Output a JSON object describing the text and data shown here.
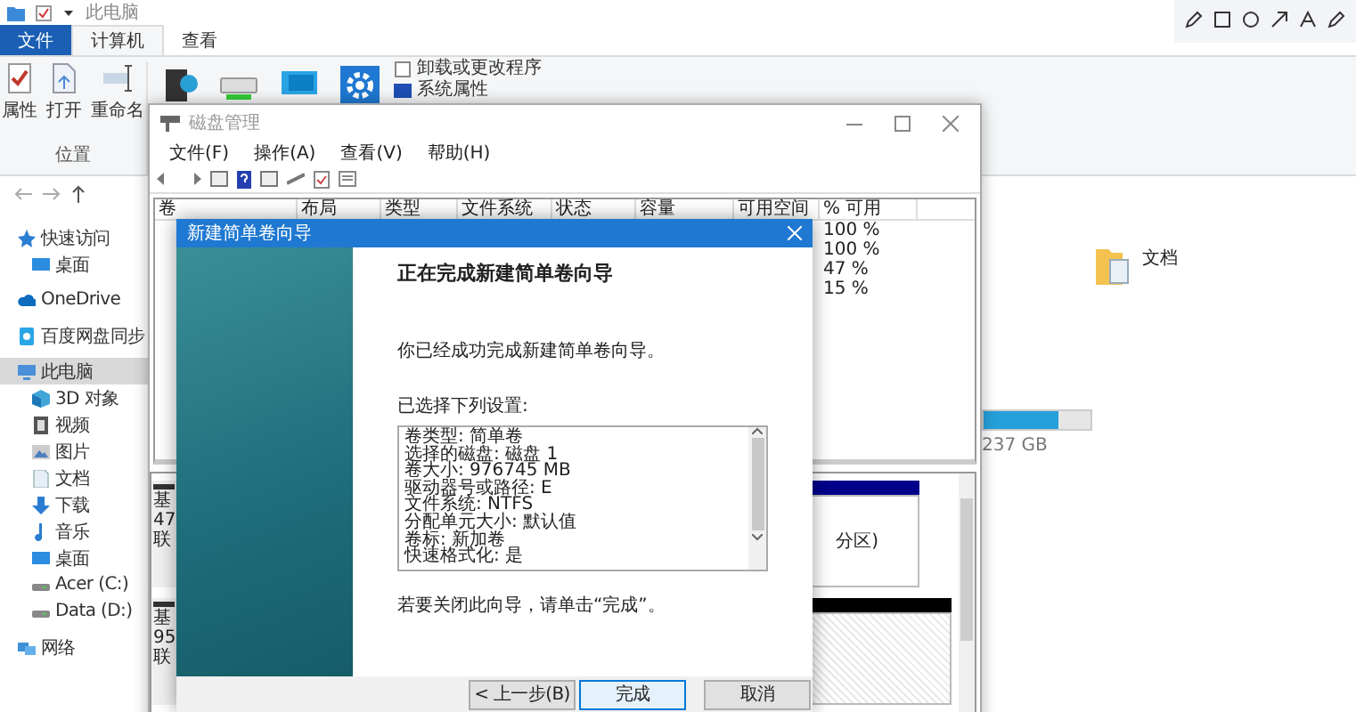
{
  "explorer": {
    "title": "此电脑",
    "ribbon_tabs": [
      {
        "label": "文件",
        "kind": "file",
        "selected": false
      },
      {
        "label": "计算机",
        "kind": "tab",
        "selected": true
      },
      {
        "label": "查看",
        "kind": "tab",
        "selected": false
      }
    ],
    "ribbon_buttons": [
      {
        "label": "属性",
        "kind": "properties"
      },
      {
        "label": "打开",
        "kind": "open"
      },
      {
        "label": "重命名",
        "kind": "rename"
      }
    ],
    "ribbon_group": "位置",
    "system_links": [
      {
        "label": "卸载或更改程序",
        "kind": "uninstall"
      },
      {
        "label": "系统属性",
        "kind": "sysprops"
      }
    ],
    "nav": [
      {
        "label": "快速访问",
        "kind": "star",
        "selected": false,
        "children": [
          {
            "label": "桌面",
            "kind": "desktop",
            "selected": false
          }
        ]
      },
      {
        "label": "OneDrive",
        "kind": "cloud",
        "selected": false
      },
      {
        "label": "百度网盘同步",
        "kind": "sync",
        "selected": false
      },
      {
        "label": "此电脑",
        "kind": "pc",
        "selected": true,
        "children": [
          {
            "label": "3D 对象",
            "kind": "cube",
            "selected": false
          },
          {
            "label": "视频",
            "kind": "video",
            "selected": false
          },
          {
            "label": "图片",
            "kind": "picture",
            "selected": false
          },
          {
            "label": "文档",
            "kind": "doc",
            "selected": false
          },
          {
            "label": "下载",
            "kind": "download",
            "selected": false
          },
          {
            "label": "音乐",
            "kind": "music",
            "selected": false
          },
          {
            "label": "桌面",
            "kind": "desktop",
            "selected": false
          },
          {
            "label": "Acer (C:)",
            "kind": "drive",
            "selected": false
          },
          {
            "label": "Data (D:)",
            "kind": "drive",
            "selected": false
          }
        ]
      },
      {
        "label": "网络",
        "kind": "network",
        "selected": false
      }
    ],
    "folder": {
      "label": "文档"
    },
    "drive": {
      "level": 0.7,
      "size": "237 GB"
    }
  },
  "disk_management": {
    "title": "磁盘管理",
    "menu": [
      "文件(F)",
      "操作(A)",
      "查看(V)",
      "帮助(H)"
    ],
    "columns": [
      "卷",
      "布局",
      "类型",
      "文件系统",
      "状态",
      "容量",
      "可用空间",
      "% 可用"
    ],
    "rows": [
      {
        "free_percent": "100 %"
      },
      {
        "free_percent": "100 %"
      },
      {
        "free_percent": "47 %"
      },
      {
        "free_percent": "15 %"
      }
    ],
    "disks": [
      {
        "lines": [
          "基",
          "47",
          "联"
        ]
      },
      {
        "lines": [
          "基",
          "95",
          "联"
        ]
      }
    ],
    "partition_text": "分区)"
  },
  "wizard": {
    "title": "新建简单卷向导",
    "heading": "正在完成新建简单卷向导",
    "message": "你已经成功完成新建简单卷向导。",
    "settings_label": "已选择下列设置:",
    "settings": [
      "卷类型: 简单卷",
      "选择的磁盘: 磁盘 1",
      "卷大小: 976745 MB",
      "驱动器号或路径: E",
      "文件系统: NTFS",
      "分配单元大小: 默认值",
      "卷标: 新加卷",
      "快速格式化: 是"
    ],
    "close_hint": "若要关闭此向导，请单击“完成”。",
    "buttons": [
      {
        "label": "< 上一步(B)",
        "default": false
      },
      {
        "label": "完成",
        "default": true
      },
      {
        "label": "取消",
        "default": false
      }
    ]
  }
}
